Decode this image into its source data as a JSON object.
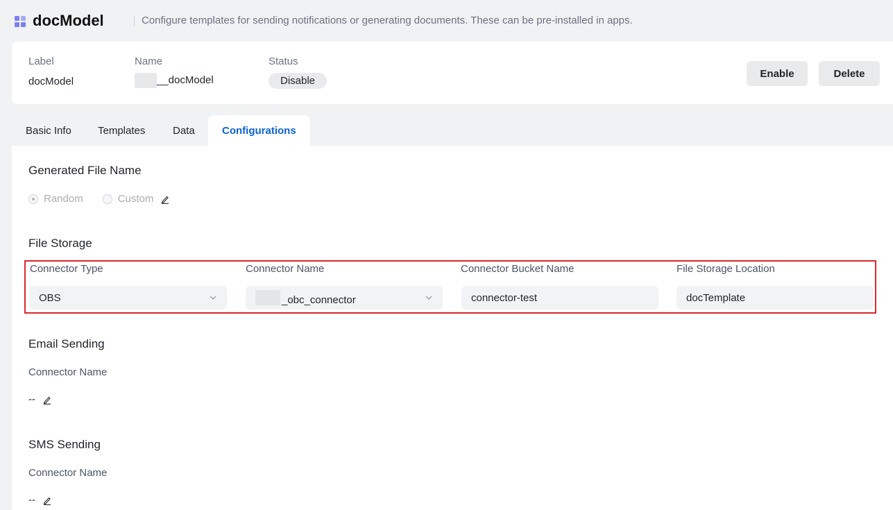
{
  "header": {
    "title": "docModel",
    "description": "Configure templates for sending notifications or generating documents. These can be pre-installed in apps."
  },
  "summary": {
    "label_heading": "Label",
    "label_value": "docModel",
    "name_heading": "Name",
    "name_value": "__docModel",
    "status_heading": "Status",
    "status_value": "Disable",
    "enable_button": "Enable",
    "delete_button": "Delete"
  },
  "tabs": [
    "Basic Info",
    "Templates",
    "Data",
    "Configurations"
  ],
  "active_tab": "Configurations",
  "generated_file_name": {
    "title": "Generated File Name",
    "options": [
      {
        "label": "Random",
        "checked": true
      },
      {
        "label": "Custom",
        "checked": false
      }
    ]
  },
  "file_storage": {
    "title": "File Storage",
    "connector_type_label": "Connector Type",
    "connector_type_value": "OBS",
    "connector_name_label": "Connector Name",
    "connector_name_value": "_obc_connector",
    "bucket_label": "Connector Bucket Name",
    "bucket_value": "connector-test",
    "location_label": "File Storage Location",
    "location_value": "docTemplate"
  },
  "email_sending": {
    "title": "Email Sending",
    "connector_label": "Connector Name",
    "connector_value": "--"
  },
  "sms_sending": {
    "title": "SMS Sending",
    "connector_label": "Connector Name",
    "connector_value": "--"
  },
  "colors": {
    "accent": "#0b63ce",
    "app_icon": "#7b7ff2",
    "highlight_border": "#d9262c"
  },
  "icons": {
    "app": "grid-app-icon",
    "edit": "pencil-icon",
    "dropdown": "chevron-down-icon"
  }
}
